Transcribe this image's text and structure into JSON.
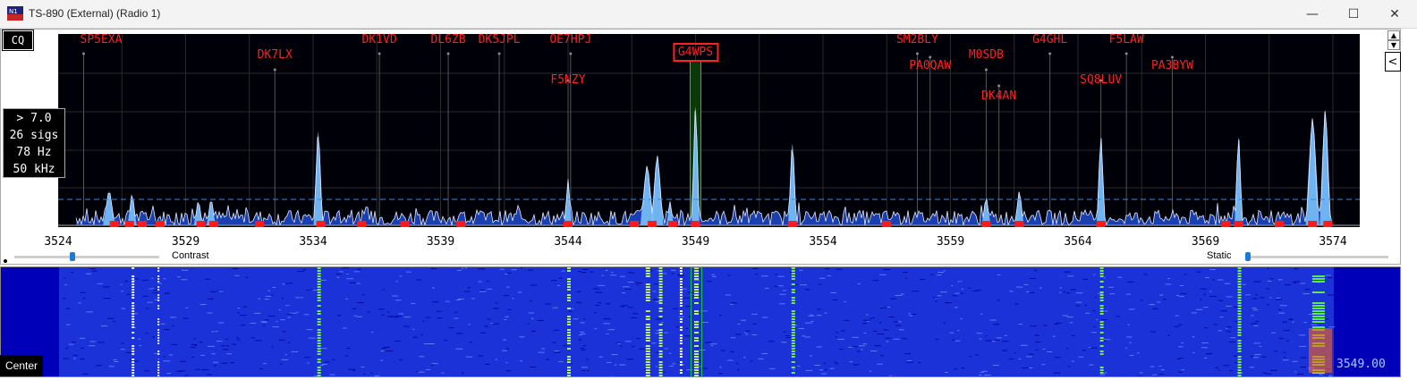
{
  "window": {
    "title": "TS-890 (External) (Radio 1)",
    "minimize": "—",
    "maximize": "☐",
    "close": "✕"
  },
  "controls": {
    "cq_label": "CQ",
    "center_label": "Center",
    "contrast_label": "Contrast",
    "static_label": "Static",
    "side_button": "<",
    "scroll_up": "▲",
    "scroll_down": "▼",
    "contrast_level": 0.4,
    "static_level": 0.02
  },
  "info": {
    "threshold": "> 7.0",
    "signals": "26 sigs",
    "resolution": "78 Hz",
    "span": "50 kHz"
  },
  "frequency_axis": {
    "start": 3524,
    "end": 3574,
    "labels": [
      "3524",
      "3529",
      "3534",
      "3539",
      "3544",
      "3549",
      "3554",
      "3559",
      "3564",
      "3569",
      "3574"
    ]
  },
  "readout": "3549.00",
  "selected_frequency": 3549.0,
  "colors": {
    "spot": "#ff2020",
    "spectrum_dark": "#1a3fb0",
    "spectrum_light": "#7fc8ff",
    "waterfall_bg": "#0000b8",
    "highlight": "#20c040"
  },
  "spots": [
    {
      "call": "SP5EXA",
      "freq": 3525.0,
      "row": 0
    },
    {
      "call": "DK7LX",
      "freq": 3532.5,
      "row": 1
    },
    {
      "call": "DK1VD",
      "freq": 3536.6,
      "row": 0
    },
    {
      "call": "DL6ZB",
      "freq": 3539.3,
      "row": 0
    },
    {
      "call": "DK5JPL",
      "freq": 3541.3,
      "row": 0
    },
    {
      "call": "OE7HPJ",
      "freq": 3544.1,
      "row": 0
    },
    {
      "call": "F5NZY",
      "freq": 3544.0,
      "row": 3
    },
    {
      "call": "G4WPS",
      "freq": 3549.0,
      "row": 1,
      "selected": true
    },
    {
      "call": "SM2BLY",
      "freq": 3557.7,
      "row": 0
    },
    {
      "call": "PA0QAW",
      "freq": 3558.2,
      "row": 2
    },
    {
      "call": "M0SDB",
      "freq": 3560.4,
      "row": 1
    },
    {
      "call": "DK4AN",
      "freq": 3560.9,
      "row": 4
    },
    {
      "call": "G4GHL",
      "freq": 3562.9,
      "row": 0
    },
    {
      "call": "F5LAW",
      "freq": 3565.9,
      "row": 0
    },
    {
      "call": "SQ8LUV",
      "freq": 3564.9,
      "row": 3
    },
    {
      "call": "PA3BYW",
      "freq": 3567.7,
      "row": 2
    }
  ],
  "peaks": [
    {
      "f": 3526.0,
      "h": 0.2,
      "w": 0.2
    },
    {
      "f": 3526.9,
      "h": 0.18,
      "w": 0.15
    },
    {
      "f": 3529.5,
      "h": 0.14,
      "w": 0.15
    },
    {
      "f": 3530.0,
      "h": 0.15,
      "w": 0.15
    },
    {
      "f": 3534.2,
      "h": 0.55,
      "w": 0.15
    },
    {
      "f": 3544.0,
      "h": 0.27,
      "w": 0.12
    },
    {
      "f": 3547.1,
      "h": 0.35,
      "w": 0.22
    },
    {
      "f": 3547.5,
      "h": 0.41,
      "w": 0.2
    },
    {
      "f": 3548.0,
      "h": 0.14,
      "w": 0.12
    },
    {
      "f": 3549.0,
      "h": 0.7,
      "w": 0.13
    },
    {
      "f": 3552.8,
      "h": 0.48,
      "w": 0.14
    },
    {
      "f": 3560.4,
      "h": 0.16,
      "w": 0.15
    },
    {
      "f": 3561.7,
      "h": 0.2,
      "w": 0.15
    },
    {
      "f": 3564.9,
      "h": 0.52,
      "w": 0.14
    },
    {
      "f": 3570.3,
      "h": 0.52,
      "w": 0.13
    },
    {
      "f": 3573.2,
      "h": 0.63,
      "w": 0.22
    },
    {
      "f": 3573.7,
      "h": 0.68,
      "w": 0.18
    }
  ],
  "markers": [
    3526.2,
    3526.8,
    3527.3,
    3528.0,
    3529.6,
    3530.1,
    3531.9,
    3534.3,
    3535.9,
    3537.6,
    3539.8,
    3544.0,
    3546.6,
    3547.3,
    3548.1,
    3549.0,
    3552.8,
    3556.5,
    3560.4,
    3561.7,
    3564.9,
    3569.8,
    3570.3,
    3571.9,
    3573.2,
    3573.8
  ],
  "waterfall_lines": [
    {
      "f": 3526.9,
      "c": "#ffffff",
      "w": 3
    },
    {
      "f": 3527.9,
      "c": "#ffffff",
      "w": 2
    },
    {
      "f": 3534.2,
      "c": "#80ff40",
      "w": 4
    },
    {
      "f": 3544.0,
      "c": "#c0ff60",
      "w": 4
    },
    {
      "f": 3547.1,
      "c": "#d0ff80",
      "w": 5
    },
    {
      "f": 3547.6,
      "c": "#c0ff60",
      "w": 4
    },
    {
      "f": 3548.4,
      "c": "#ffffff",
      "w": 3
    },
    {
      "f": 3549.0,
      "c": "#d0ff80",
      "w": 5
    },
    {
      "f": 3552.8,
      "c": "#80ff40",
      "w": 4
    },
    {
      "f": 3564.9,
      "c": "#80ff40",
      "w": 4
    },
    {
      "f": 3570.3,
      "c": "#80ff40",
      "w": 4
    },
    {
      "f": 3573.4,
      "c": "#60ff40",
      "w": 14
    }
  ]
}
